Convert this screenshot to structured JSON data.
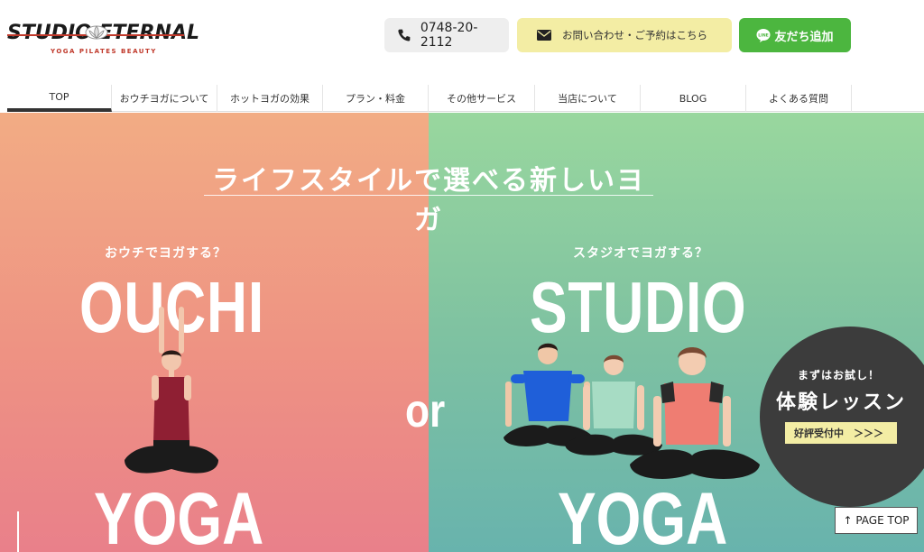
{
  "logo": {
    "text": "STUDIO ETERNAL",
    "tagline": "YOGA PILATES BEAUTY"
  },
  "header": {
    "phone": "0748-20-2112",
    "contact_label": "お問い合わせ・ご予約はこちら",
    "line_label": "友だち追加"
  },
  "nav": {
    "items": [
      {
        "label": "TOP"
      },
      {
        "label": "おウチヨガについて"
      },
      {
        "label": "ホットヨガの効果"
      },
      {
        "label": "プラン・料金"
      },
      {
        "label": "その他サービス"
      },
      {
        "label": "当店について"
      },
      {
        "label": "BLOG"
      },
      {
        "label": "よくある質問"
      }
    ]
  },
  "hero": {
    "title": "ライフスタイルで選べる新しいヨガ",
    "left_sub": "おウチでヨガする？",
    "left_big": "OUCHI",
    "left_bottom": "YOGA",
    "right_sub": "スタジオでヨガする？",
    "right_big": "STUDIO",
    "right_bottom": "YOGA",
    "or": "or"
  },
  "trial": {
    "line1": "まずはお試し！",
    "line2": "体験レッスン",
    "badge": "好評受付中　＞＞＞"
  },
  "page_top": "↑ PAGE TOP",
  "colors": {
    "accent_red": "#c0392b",
    "line_green": "#4cb63f",
    "contact_yellow": "#f3eda4",
    "left_panel": "#ee9283",
    "right_panel": "#7fc2a1"
  }
}
